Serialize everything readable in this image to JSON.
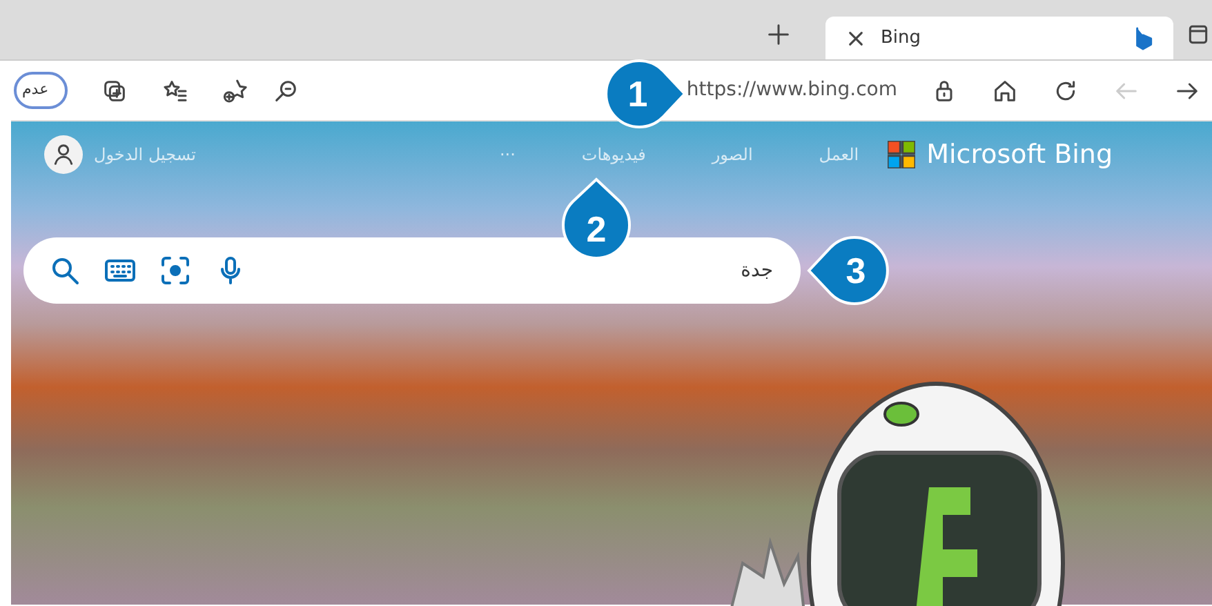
{
  "tabs": [
    {
      "title": "Bing",
      "selected": true
    }
  ],
  "toolbar": {
    "address": "https://www.bing.com",
    "back_disabled": true,
    "sync_button": "عدم"
  },
  "page": {
    "logo": "Microsoft Bing",
    "nav": [
      {
        "label": "العمل"
      },
      {
        "label": "الصور"
      },
      {
        "label": "فيديوهات"
      },
      {
        "label": "···"
      }
    ],
    "sign_in": "تسجيل الدخول",
    "search": {
      "value": "جدة"
    }
  },
  "callouts": [
    {
      "number": "1",
      "kind": "right"
    },
    {
      "number": "2",
      "kind": "up"
    },
    {
      "number": "3",
      "kind": "left"
    }
  ]
}
